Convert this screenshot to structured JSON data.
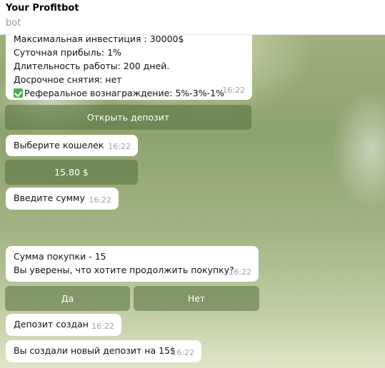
{
  "header": {
    "title": "Your Profitbot",
    "subtitle": "bot"
  },
  "messages": {
    "deposit_info": {
      "lines": [
        "Максимальная инвестиция : 30000$",
        "Суточная прибыль: 1%",
        "Длительность работы: 200 дней.",
        "Досрочное снятия: нет",
        "Реферальное вознаграждение: 5%-3%-1%"
      ],
      "time": "16:22"
    },
    "open_deposit_button": "Открыть депозит",
    "choose_wallet": {
      "text": "Выберите кошелек",
      "time": "16:22"
    },
    "wallet_button": "15.80 $",
    "enter_amount": {
      "text": "Введите сумму",
      "time": "16:22"
    },
    "confirm": {
      "line1": "Сумма покупки - 15",
      "line2": "Вы уверены, что хотите продолжить покупку?",
      "time": "16:22"
    },
    "yes_button": "Да",
    "no_button": "Нет",
    "deposit_created": {
      "text": "Депозит создан",
      "time": "16:22"
    },
    "new_deposit": {
      "text": "Вы создали новый депозит на 15$",
      "time": "16:22"
    }
  },
  "icons": {
    "referral": "check-leaf-icon"
  },
  "colors": {
    "button_bg": "#6b8750",
    "bubble_bg": "#ffffff",
    "time_text": "#9aa3ab"
  }
}
